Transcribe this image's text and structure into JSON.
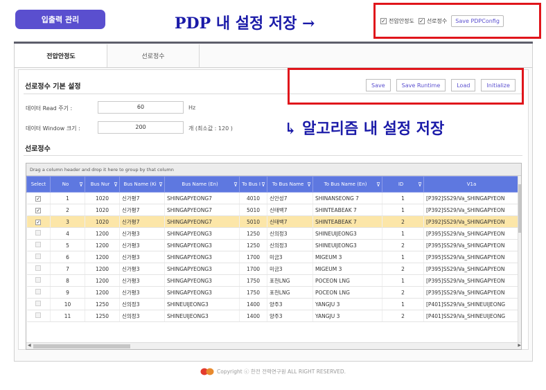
{
  "header": {
    "io_button": "입출력 관리"
  },
  "annotations": {
    "top": "PDP 내 설정 저장 →",
    "middle": "↳ 알고리즘 내 설정 저장"
  },
  "pdp_config": {
    "check1_label": "전압안정도",
    "check2_label": "선로정수",
    "check_mark": "✓",
    "save_button": "Save PDPConfig"
  },
  "tabs": [
    {
      "label": "전압안정도",
      "active": true
    },
    {
      "label": "선로정수",
      "active": false
    }
  ],
  "settings": {
    "title": "선로정수 기본 설정",
    "buttons": {
      "save": "Save",
      "save_runtime": "Save Runtime",
      "load": "Load",
      "initialize": "Initialize"
    },
    "read_period": {
      "label": "데이터 Read 주기 :",
      "value": "60",
      "unit": "Hz"
    },
    "window_size": {
      "label": "데이터 Window 크기 :",
      "value": "200",
      "unit": "개 (최소값 : 120 )"
    }
  },
  "grid": {
    "title": "선로정수",
    "group_hint": "Drag a column header and drop it here to group by that column",
    "filter_icon": "⊽",
    "columns": [
      "Select",
      "No",
      "Bus Nur",
      "Bus Name (Ki",
      "Bus Name (En)",
      "To Bus I",
      "To Bus Name",
      "To Bus Name (En)",
      "ID",
      "V1a"
    ],
    "rows": [
      {
        "checked": true,
        "no": "1",
        "bus_num": "1020",
        "bus_name_ko": "신가평7",
        "bus_name_en": "SHINGAPYEONG7",
        "to_bus": "4010",
        "to_bus_name": "신안성7",
        "to_bus_name_en": "SHINANSEONG 7",
        "id": "1",
        "v1a": "[P392]SS29/Va_SHINGAPYEON"
      },
      {
        "checked": true,
        "no": "2",
        "bus_num": "1020",
        "bus_name_ko": "신가평7",
        "bus_name_en": "SHINGAPYEONG7",
        "to_bus": "5010",
        "to_bus_name": "신태백7",
        "to_bus_name_en": "SHINTEABEAK 7",
        "id": "1",
        "v1a": "[P392]SS29/Va_SHINGAPYEON"
      },
      {
        "checked": true,
        "no": "3",
        "bus_num": "1020",
        "bus_name_ko": "신가평7",
        "bus_name_en": "SHINGAPYEONG7",
        "to_bus": "5010",
        "to_bus_name": "신태백7",
        "to_bus_name_en": "SHINTEABEAK 7",
        "id": "2",
        "v1a": "[P392]SS29/Va_SHINGAPYEON",
        "selected": true
      },
      {
        "checked": false,
        "no": "4",
        "bus_num": "1200",
        "bus_name_ko": "신가평3",
        "bus_name_en": "SHINGAPYEONG3",
        "to_bus": "1250",
        "to_bus_name": "신의정3",
        "to_bus_name_en": "SHINEUIJEONG3",
        "id": "1",
        "v1a": "[P395]SS29/Va_SHINGAPYEON"
      },
      {
        "checked": false,
        "no": "5",
        "bus_num": "1200",
        "bus_name_ko": "신가평3",
        "bus_name_en": "SHINGAPYEONG3",
        "to_bus": "1250",
        "to_bus_name": "신의정3",
        "to_bus_name_en": "SHINEUIJEONG3",
        "id": "2",
        "v1a": "[P395]SS29/Va_SHINGAPYEON"
      },
      {
        "checked": false,
        "no": "6",
        "bus_num": "1200",
        "bus_name_ko": "신가평3",
        "bus_name_en": "SHINGAPYEONG3",
        "to_bus": "1700",
        "to_bus_name": "미금3",
        "to_bus_name_en": "MIGEUM 3",
        "id": "1",
        "v1a": "[P395]SS29/Va_SHINGAPYEON"
      },
      {
        "checked": false,
        "no": "7",
        "bus_num": "1200",
        "bus_name_ko": "신가평3",
        "bus_name_en": "SHINGAPYEONG3",
        "to_bus": "1700",
        "to_bus_name": "미금3",
        "to_bus_name_en": "MIGEUM 3",
        "id": "2",
        "v1a": "[P395]SS29/Va_SHINGAPYEON"
      },
      {
        "checked": false,
        "no": "8",
        "bus_num": "1200",
        "bus_name_ko": "신가평3",
        "bus_name_en": "SHINGAPYEONG3",
        "to_bus": "1750",
        "to_bus_name": "포천LNG",
        "to_bus_name_en": "POCEON LNG",
        "id": "1",
        "v1a": "[P395]SS29/Va_SHINGAPYEON"
      },
      {
        "checked": false,
        "no": "9",
        "bus_num": "1200",
        "bus_name_ko": "신가평3",
        "bus_name_en": "SHINGAPYEONG3",
        "to_bus": "1750",
        "to_bus_name": "포천LNG",
        "to_bus_name_en": "POCEON LNG",
        "id": "2",
        "v1a": "[P395]SS29/Va_SHINGAPYEON"
      },
      {
        "checked": false,
        "no": "10",
        "bus_num": "1250",
        "bus_name_ko": "신의정3",
        "bus_name_en": "SHINEUIJEONG3",
        "to_bus": "1400",
        "to_bus_name": "양주3",
        "to_bus_name_en": "YANGJU 3",
        "id": "1",
        "v1a": "[P401]SS29/Va_SHINEUIJEONG"
      },
      {
        "checked": false,
        "no": "11",
        "bus_num": "1250",
        "bus_name_ko": "신의정3",
        "bus_name_en": "SHINEUIJEONG3",
        "to_bus": "1400",
        "to_bus_name": "양주3",
        "to_bus_name_en": "YANGJU 3",
        "id": "2",
        "v1a": "[P401]SS29/Va_SHINEUIJEONG"
      }
    ]
  },
  "footer": {
    "text": "Copyright ⓒ 한전 전력연구원 ALL RIGHT RESERVED."
  },
  "colors": {
    "accent": "#5a4fcf",
    "grid_header": "#5e78e0",
    "annotation": "#1a1aa8",
    "highlight_box": "#e0151b",
    "selected_row": "#fce6a8"
  }
}
